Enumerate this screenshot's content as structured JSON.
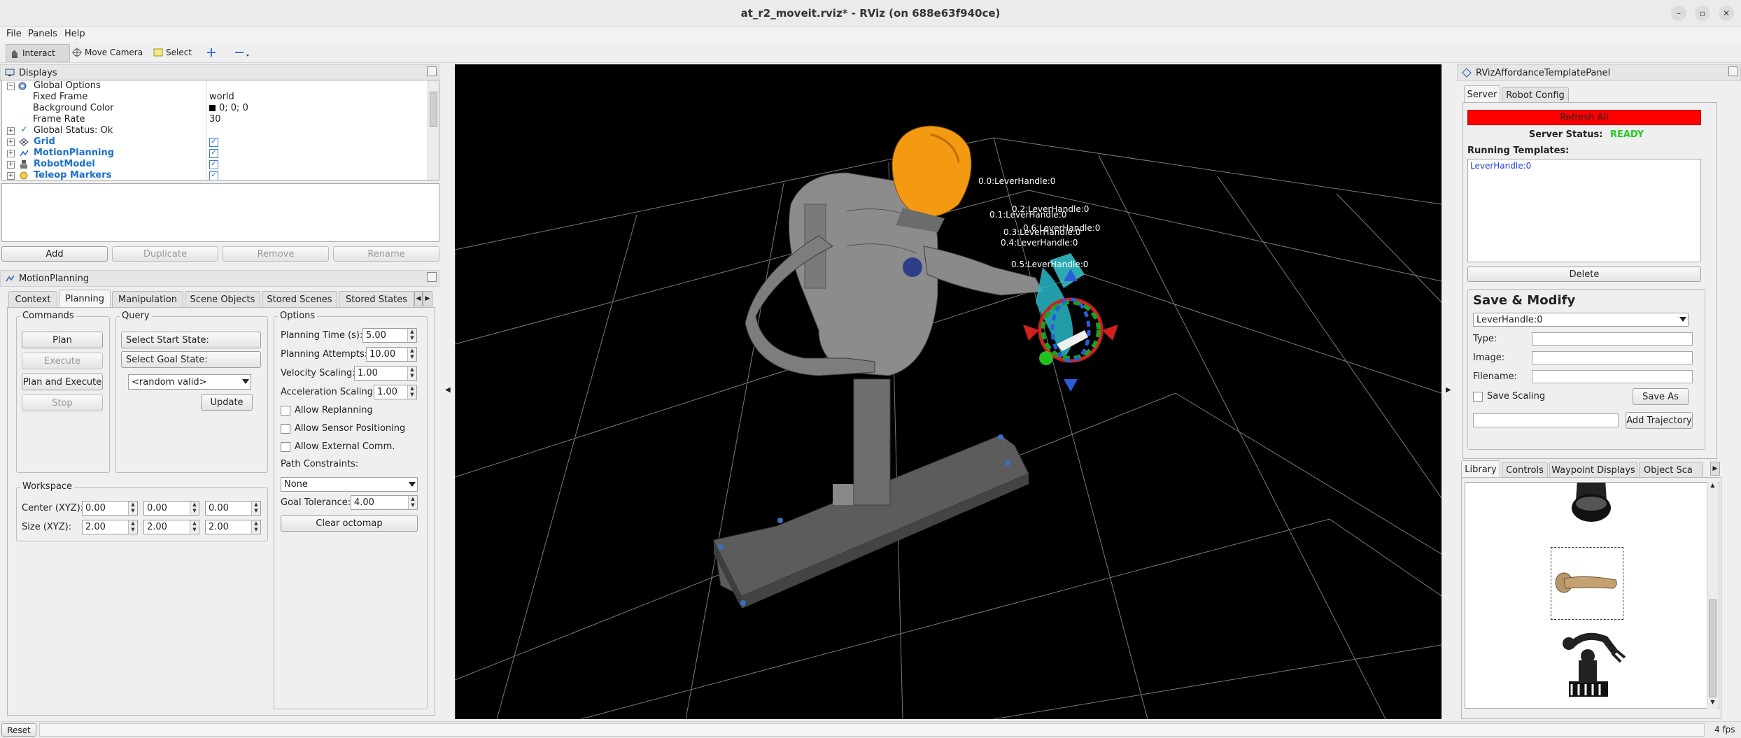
{
  "window": {
    "title": "at_r2_moveit.rviz* - RViz (on 688e63f940ce)",
    "controls": [
      "–",
      "▫",
      "✕"
    ]
  },
  "menu": [
    "File",
    "Panels",
    "Help"
  ],
  "toolbar": {
    "interact": "Interact",
    "move_camera": "Move Camera",
    "select": "Select"
  },
  "displays": {
    "title": "Displays",
    "tree": [
      {
        "label": "Global Options",
        "value": "",
        "expand": "⊟"
      },
      {
        "label": "Fixed Frame",
        "value": "world"
      },
      {
        "label": "Background Color",
        "value": "0; 0; 0"
      },
      {
        "label": "Frame Rate",
        "value": "30"
      },
      {
        "label": "Global Status: Ok",
        "value": "",
        "expand": "⊞"
      },
      {
        "label": "Grid",
        "value": "✓",
        "expand": "⊞"
      },
      {
        "label": "MotionPlanning",
        "value": "✓",
        "expand": "⊞"
      },
      {
        "label": "RobotModel",
        "value": "✓",
        "expand": "⊞"
      },
      {
        "label": "Teleop Markers",
        "value": "✓",
        "expand": "⊞"
      }
    ],
    "buttons": [
      "Add",
      "Duplicate",
      "Remove",
      "Rename"
    ]
  },
  "motion_planning": {
    "title": "MotionPlanning",
    "tabs": [
      "Context",
      "Planning",
      "Manipulation",
      "Scene Objects",
      "Stored Scenes",
      "Stored States"
    ],
    "commands": {
      "title": "Commands",
      "plan": "Plan",
      "execute": "Execute",
      "plan_execute": "Plan and Execute",
      "stop": "Stop"
    },
    "query": {
      "title": "Query",
      "start": "Select Start State:",
      "goal": "Select Goal State:",
      "combo": "<random valid>",
      "update": "Update"
    },
    "options": {
      "title": "Options",
      "planning_time_label": "Planning Time (s):",
      "planning_time": "5.00",
      "attempts_label": "Planning Attempts:",
      "attempts": "10.00",
      "velocity_label": "Velocity Scaling:",
      "velocity": "1.00",
      "accel_label": "Acceleration Scaling:",
      "accel": "1.00",
      "replanning": "Allow Replanning",
      "sensor": "Allow Sensor Positioning",
      "external": "Allow External Comm.",
      "path_constraints_label": "Path Constraints:",
      "path_constraints": "None",
      "goal_tol_label": "Goal Tolerance:",
      "goal_tol": "4.00",
      "clear_octomap": "Clear octomap"
    },
    "workspace": {
      "title": "Workspace",
      "center_label": "Center (XYZ):",
      "center": [
        "0.00",
        "0.00",
        "0.00"
      ],
      "size_label": "Size (XYZ):",
      "size": [
        "2.00",
        "2.00",
        "2.00"
      ]
    }
  },
  "viewport_labels": [
    "0.0:LeverHandle:0",
    "0.2:LeverHandle:0",
    "0.1:LeverHandle:0",
    "0.6:LeverHandle:0",
    "0.3:LeverHandle:0",
    "0.4:LeverHandle:0",
    "0.5:LeverHandle:0"
  ],
  "affordance": {
    "title": "RVizAffordanceTemplatePanel",
    "tabs": [
      "Server",
      "Robot Config"
    ],
    "refresh": "Refresh All",
    "server_status_label": "Server Status:",
    "server_status": "READY",
    "running_label": "Running Templates:",
    "running": [
      "LeverHandle:0"
    ],
    "delete": "Delete",
    "save_modify": {
      "title": "Save & Modify",
      "combo": "LeverHandle:0",
      "type": "Type:",
      "image": "Image:",
      "filename": "Filename:",
      "save_scaling": "Save Scaling",
      "save_as": "Save As",
      "add_trajectory": "Add Trajectory"
    },
    "lib_tabs": [
      "Library",
      "Controls",
      "Waypoint Displays",
      "Object Sca"
    ]
  },
  "status": {
    "reset": "Reset",
    "fps": "4 fps"
  },
  "colors": {
    "refresh_red": "#ff0000",
    "ready_green": "#22cc22",
    "tree_blue": "#1a6fc9",
    "robot_orange": "#f39a12"
  }
}
